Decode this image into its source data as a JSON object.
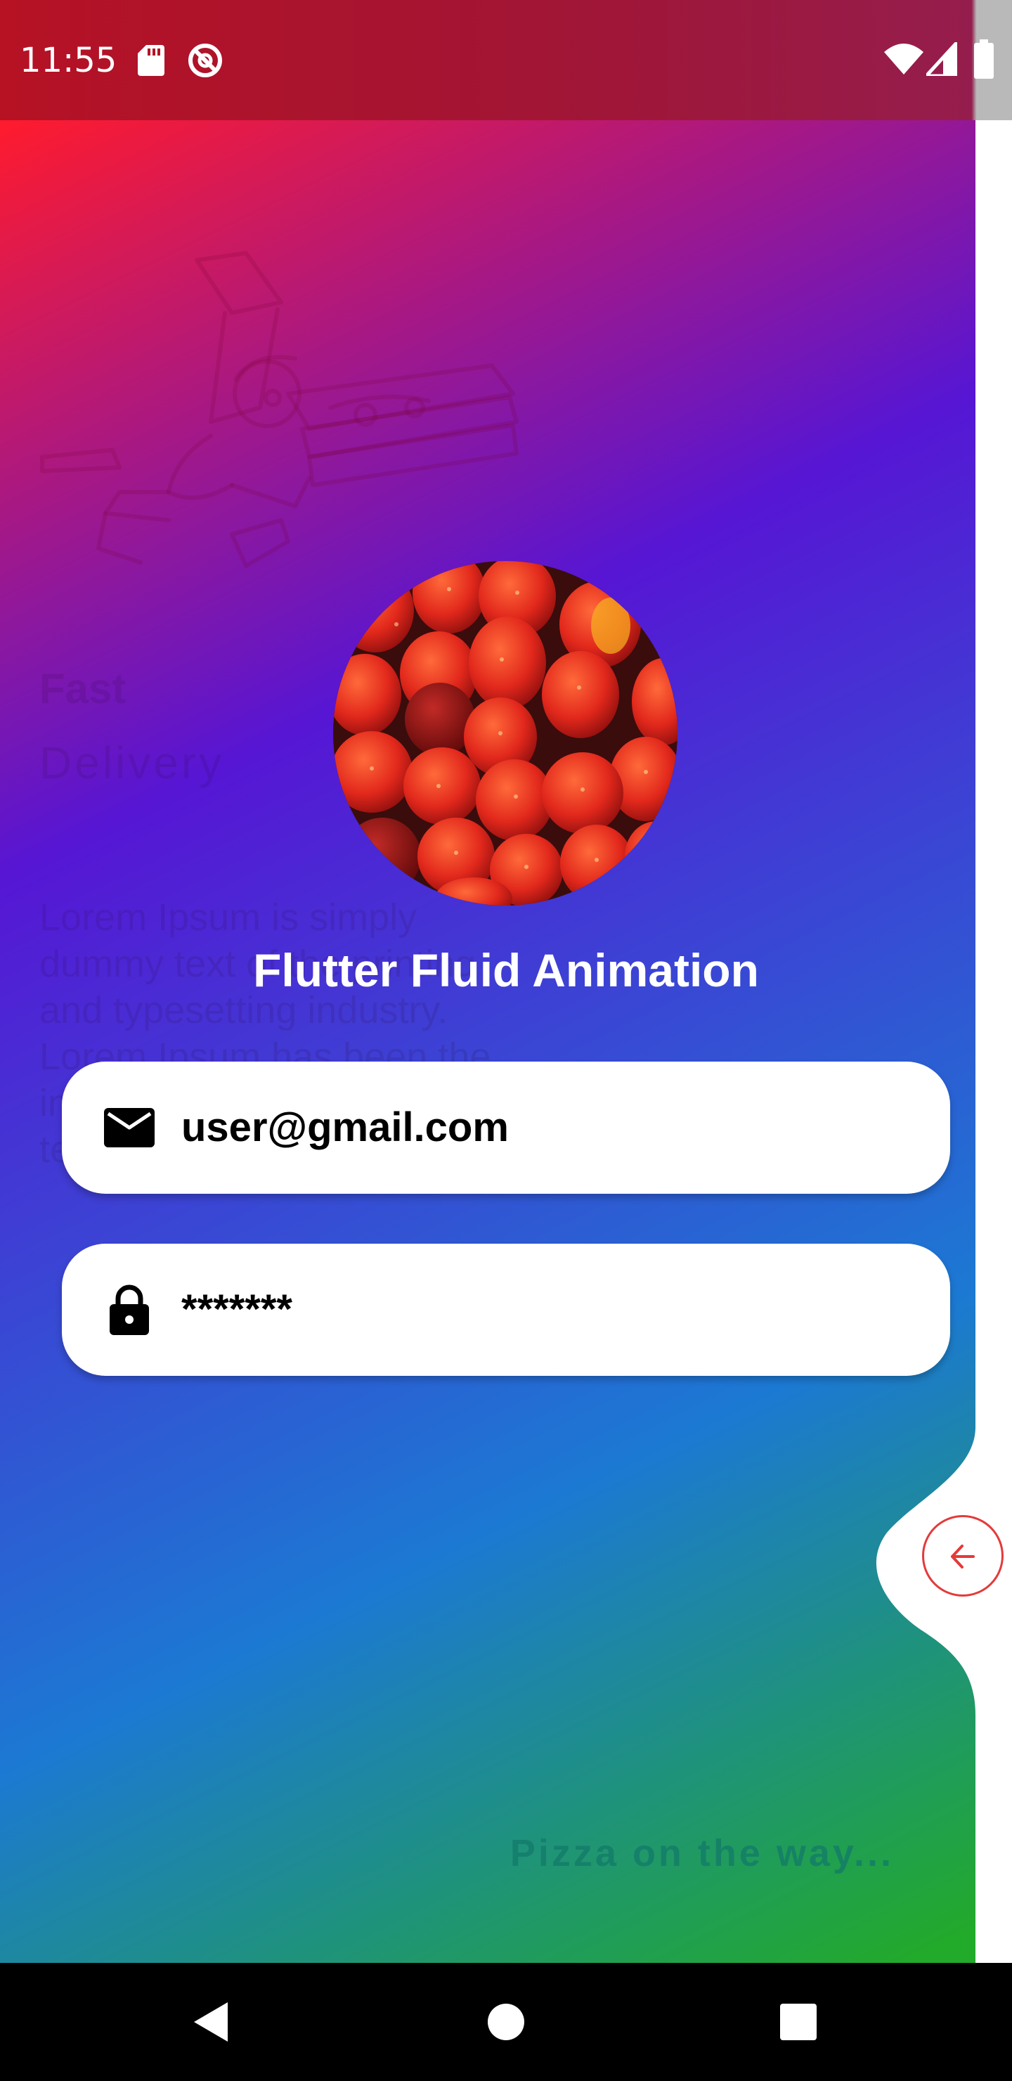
{
  "status_bar": {
    "time": "11:55",
    "icons": [
      "sd-card-icon",
      "do-not-disturb-icon",
      "wifi-icon",
      "signal-icon",
      "battery-icon"
    ]
  },
  "background": {
    "illustration": "delivery-courier-illustration",
    "title": "Fast",
    "subtitle": "Delivery",
    "paragraph": "Lorem Ipsum is simply dummy text of the printing and typesetting industry. Lorem Ipsum has been the industry's standard dummy text ever since the 1500s.",
    "caption": "Pizza on the way...",
    "gradient_colors": [
      "#ff1b2d",
      "#5616d4",
      "#1c79d3",
      "#22aa2a"
    ]
  },
  "app": {
    "title": "Flutter Fluid Animation",
    "avatar": "strawberries-image"
  },
  "form": {
    "email": {
      "icon": "mail-icon",
      "value": "user@gmail.com"
    },
    "password": {
      "icon": "lock-icon",
      "value": "*******"
    }
  },
  "back_button": {
    "icon": "arrow-left-icon",
    "color": "#e43a3a"
  },
  "nav_bar": {
    "buttons": [
      "back-icon",
      "home-icon",
      "recents-icon"
    ]
  }
}
